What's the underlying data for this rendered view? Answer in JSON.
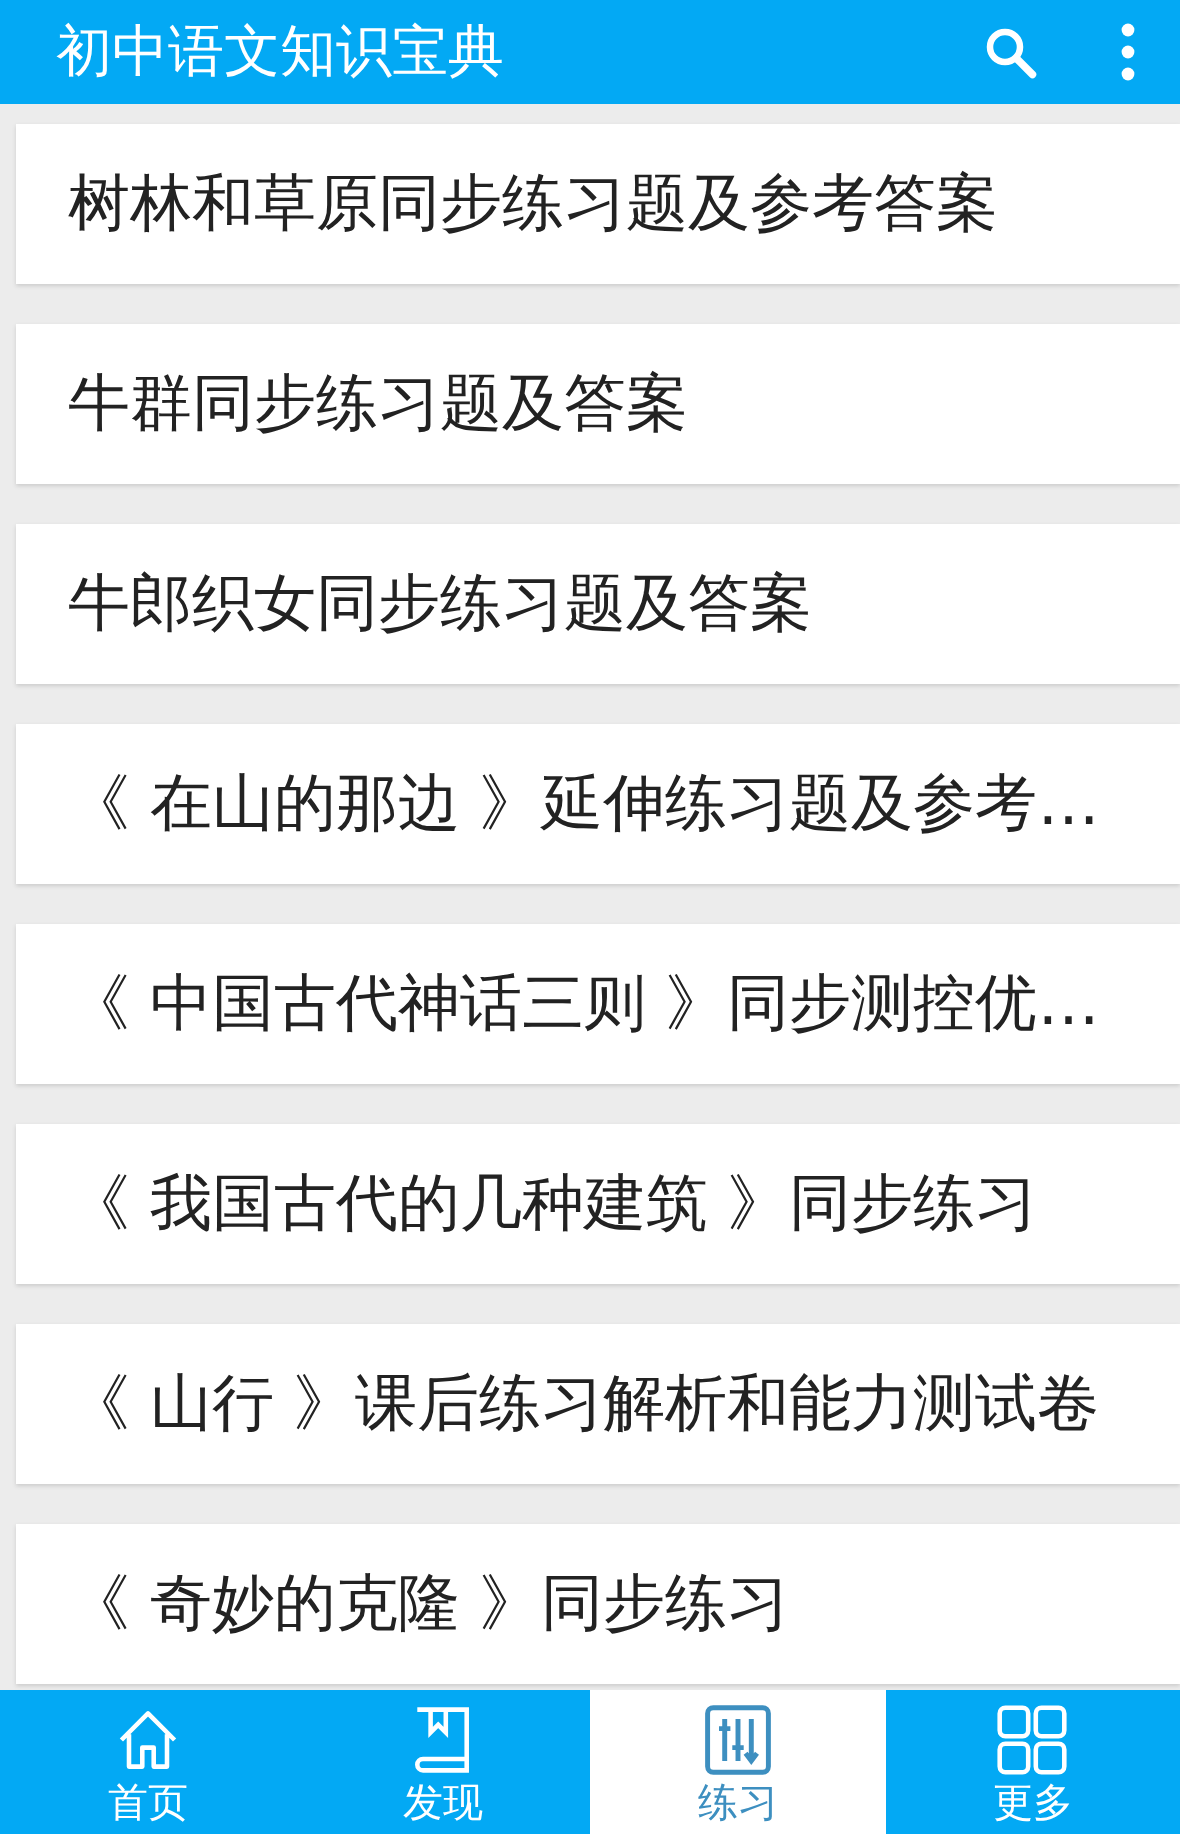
{
  "app_bar": {
    "title": "初中语文知识宝典"
  },
  "items": [
    {
      "title": "树林和草原同步练习题及参考答案"
    },
    {
      "title": "牛群同步练习题及答案"
    },
    {
      "title": "牛郎织女同步练习题及答案"
    },
    {
      "title": "《 在山的那边 》延伸练习题及参考…"
    },
    {
      "title": "《 中国古代神话三则 》同步测控优…"
    },
    {
      "title": "《 我国古代的几种建筑 》同步练习"
    },
    {
      "title": "《 山行 》课后练习解析和能力测试卷"
    },
    {
      "title": "《 奇妙的克隆 》同步练习"
    }
  ],
  "bottom_nav": [
    {
      "label": "首页",
      "selected": false
    },
    {
      "label": "发现",
      "selected": false
    },
    {
      "label": "练习",
      "selected": true
    },
    {
      "label": "更多",
      "selected": false
    }
  ]
}
